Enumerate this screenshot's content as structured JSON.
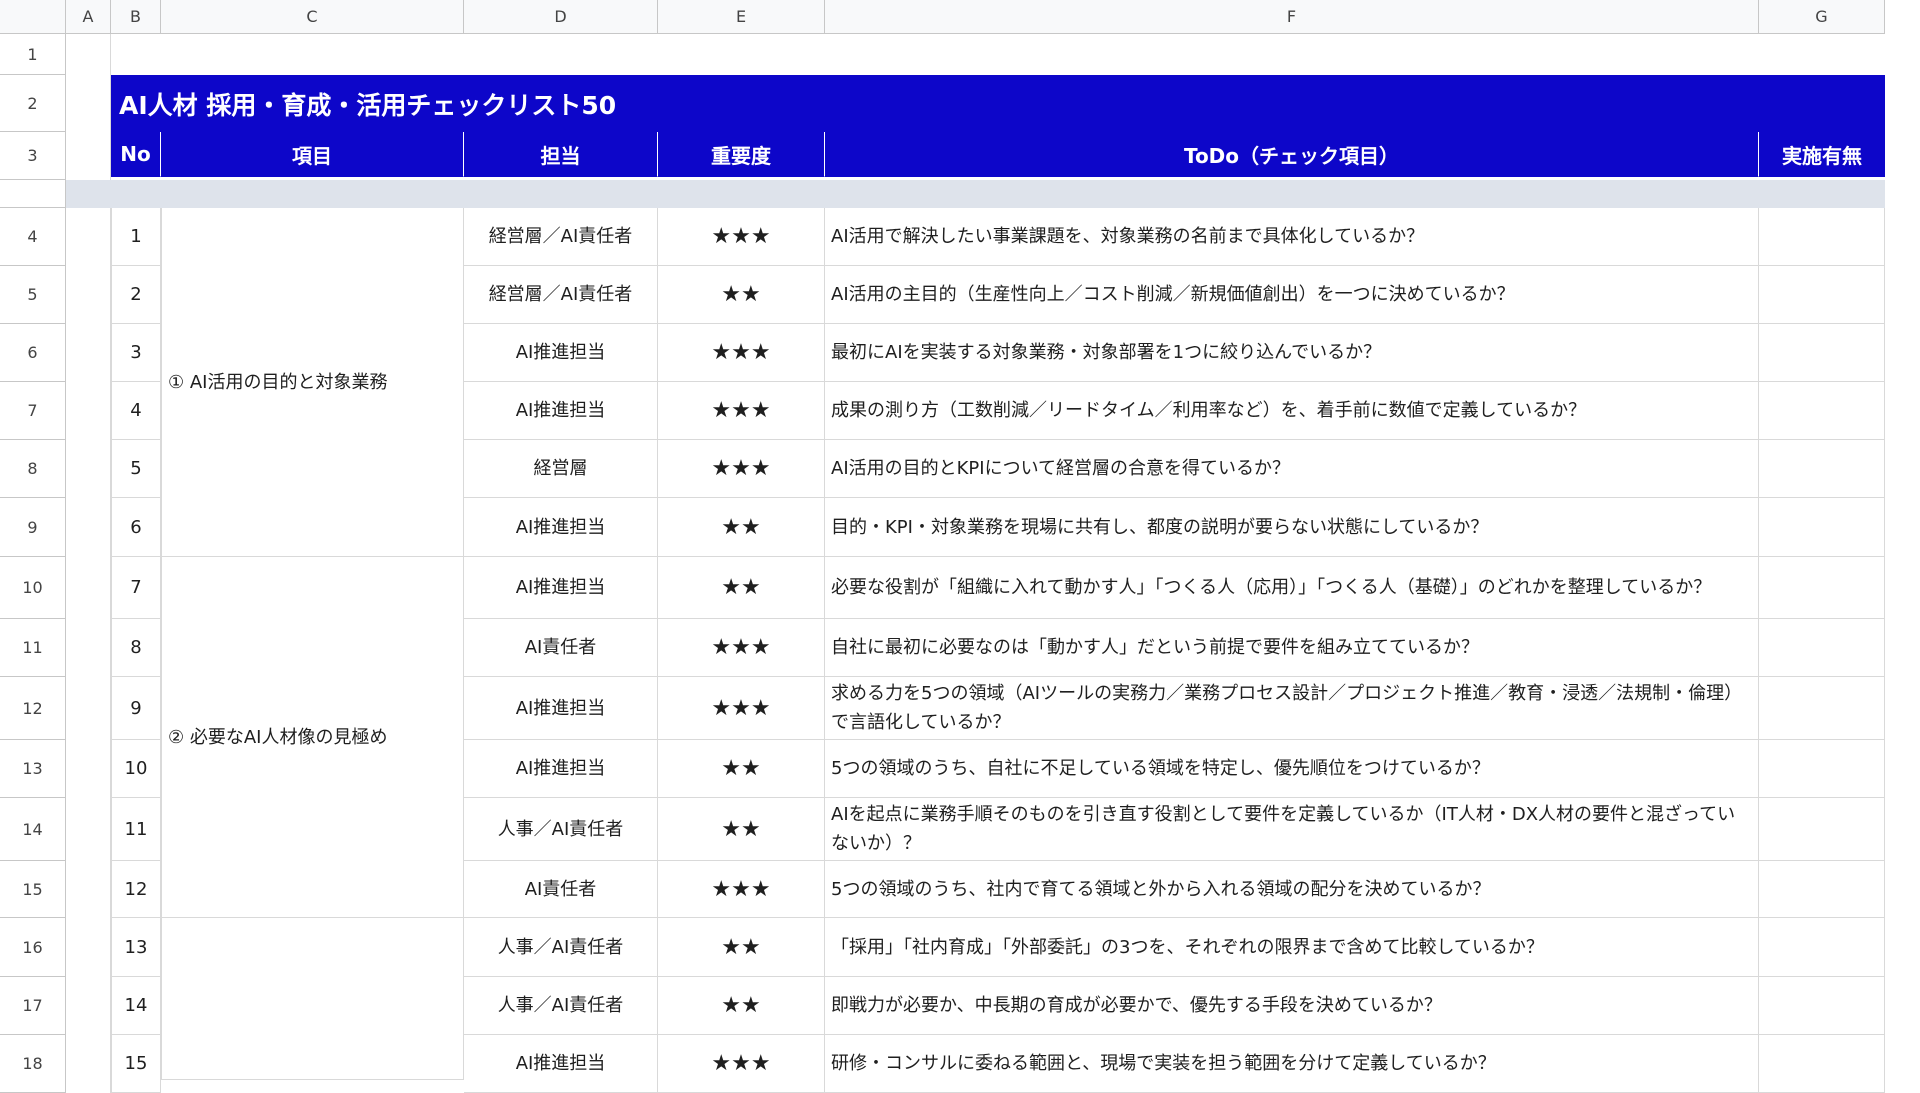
{
  "columns": [
    "A",
    "B",
    "C",
    "D",
    "E",
    "F",
    "G"
  ],
  "row_numbers": [
    "1",
    "2",
    "3",
    "",
    "4",
    "5",
    "6",
    "7",
    "8",
    "9",
    "10",
    "11",
    "12",
    "13",
    "14",
    "15",
    "16",
    "17",
    "18"
  ],
  "title": "AI人材 採用・育成・活用チェックリスト50",
  "headers": {
    "no": "No",
    "item": "項目",
    "owner": "担当",
    "importance": "重要度",
    "todo": "ToDo（チェック項目）",
    "done": "実施有無"
  },
  "groups": [
    "① AI活用の目的と対象業務",
    "② 必要なAI人材像の見極め",
    ""
  ],
  "rows": [
    {
      "no": "1",
      "owner": "経営層／AI責任者",
      "stars": "★★★",
      "todo": "AI活用で解決したい事業課題を、対象業務の名前まで具体化しているか？"
    },
    {
      "no": "2",
      "owner": "経営層／AI責任者",
      "stars": "★★",
      "todo": "AI活用の主目的（生産性向上／コスト削減／新規価値創出）を一つに決めているか？"
    },
    {
      "no": "3",
      "owner": "AI推進担当",
      "stars": "★★★",
      "todo": "最初にAIを実装する対象業務・対象部署を1つに絞り込んでいるか？"
    },
    {
      "no": "4",
      "owner": "AI推進担当",
      "stars": "★★★",
      "todo": "成果の測り方（工数削減／リードタイム／利用率など）を、着手前に数値で定義しているか？"
    },
    {
      "no": "5",
      "owner": "経営層",
      "stars": "★★★",
      "todo": "AI活用の目的とKPIについて経営層の合意を得ているか？"
    },
    {
      "no": "6",
      "owner": "AI推進担当",
      "stars": "★★",
      "todo": "目的・KPI・対象業務を現場に共有し、都度の説明が要らない状態にしているか？"
    },
    {
      "no": "7",
      "owner": "AI推進担当",
      "stars": "★★",
      "todo": "必要な役割が「組織に入れて動かす人」「つくる人（応用）」「つくる人（基礎）」のどれかを整理しているか？"
    },
    {
      "no": "8",
      "owner": "AI責任者",
      "stars": "★★★",
      "todo": "自社に最初に必要なのは「動かす人」だという前提で要件を組み立てているか？"
    },
    {
      "no": "9",
      "owner": "AI推進担当",
      "stars": "★★★",
      "todo": "求める力を5つの領域（AIツールの実務力／業務プロセス設計／プロジェクト推進／教育・浸透／法規制・倫理）で言語化しているか？"
    },
    {
      "no": "10",
      "owner": "AI推進担当",
      "stars": "★★",
      "todo": "5つの領域のうち、自社に不足している領域を特定し、優先順位をつけているか？"
    },
    {
      "no": "11",
      "owner": "人事／AI責任者",
      "stars": "★★",
      "todo": "AIを起点に業務手順そのものを引き直す役割として要件を定義しているか（IT人材・DX人材の要件と混ざっていないか）？"
    },
    {
      "no": "12",
      "owner": "AI責任者",
      "stars": "★★★",
      "todo": "5つの領域のうち、社内で育てる領域と外から入れる領域の配分を決めているか？"
    },
    {
      "no": "13",
      "owner": "人事／AI責任者",
      "stars": "★★",
      "todo": "「採用」「社内育成」「外部委託」の3つを、それぞれの限界まで含めて比較しているか？"
    },
    {
      "no": "14",
      "owner": "人事／AI責任者",
      "stars": "★★",
      "todo": "即戦力が必要か、中長期の育成が必要かで、優先する手段を決めているか？"
    },
    {
      "no": "15",
      "owner": "AI推進担当",
      "stars": "★★★",
      "todo": "研修・コンサルに委ねる範囲と、現場で実装を担う範囲を分けて定義しているか？"
    }
  ]
}
